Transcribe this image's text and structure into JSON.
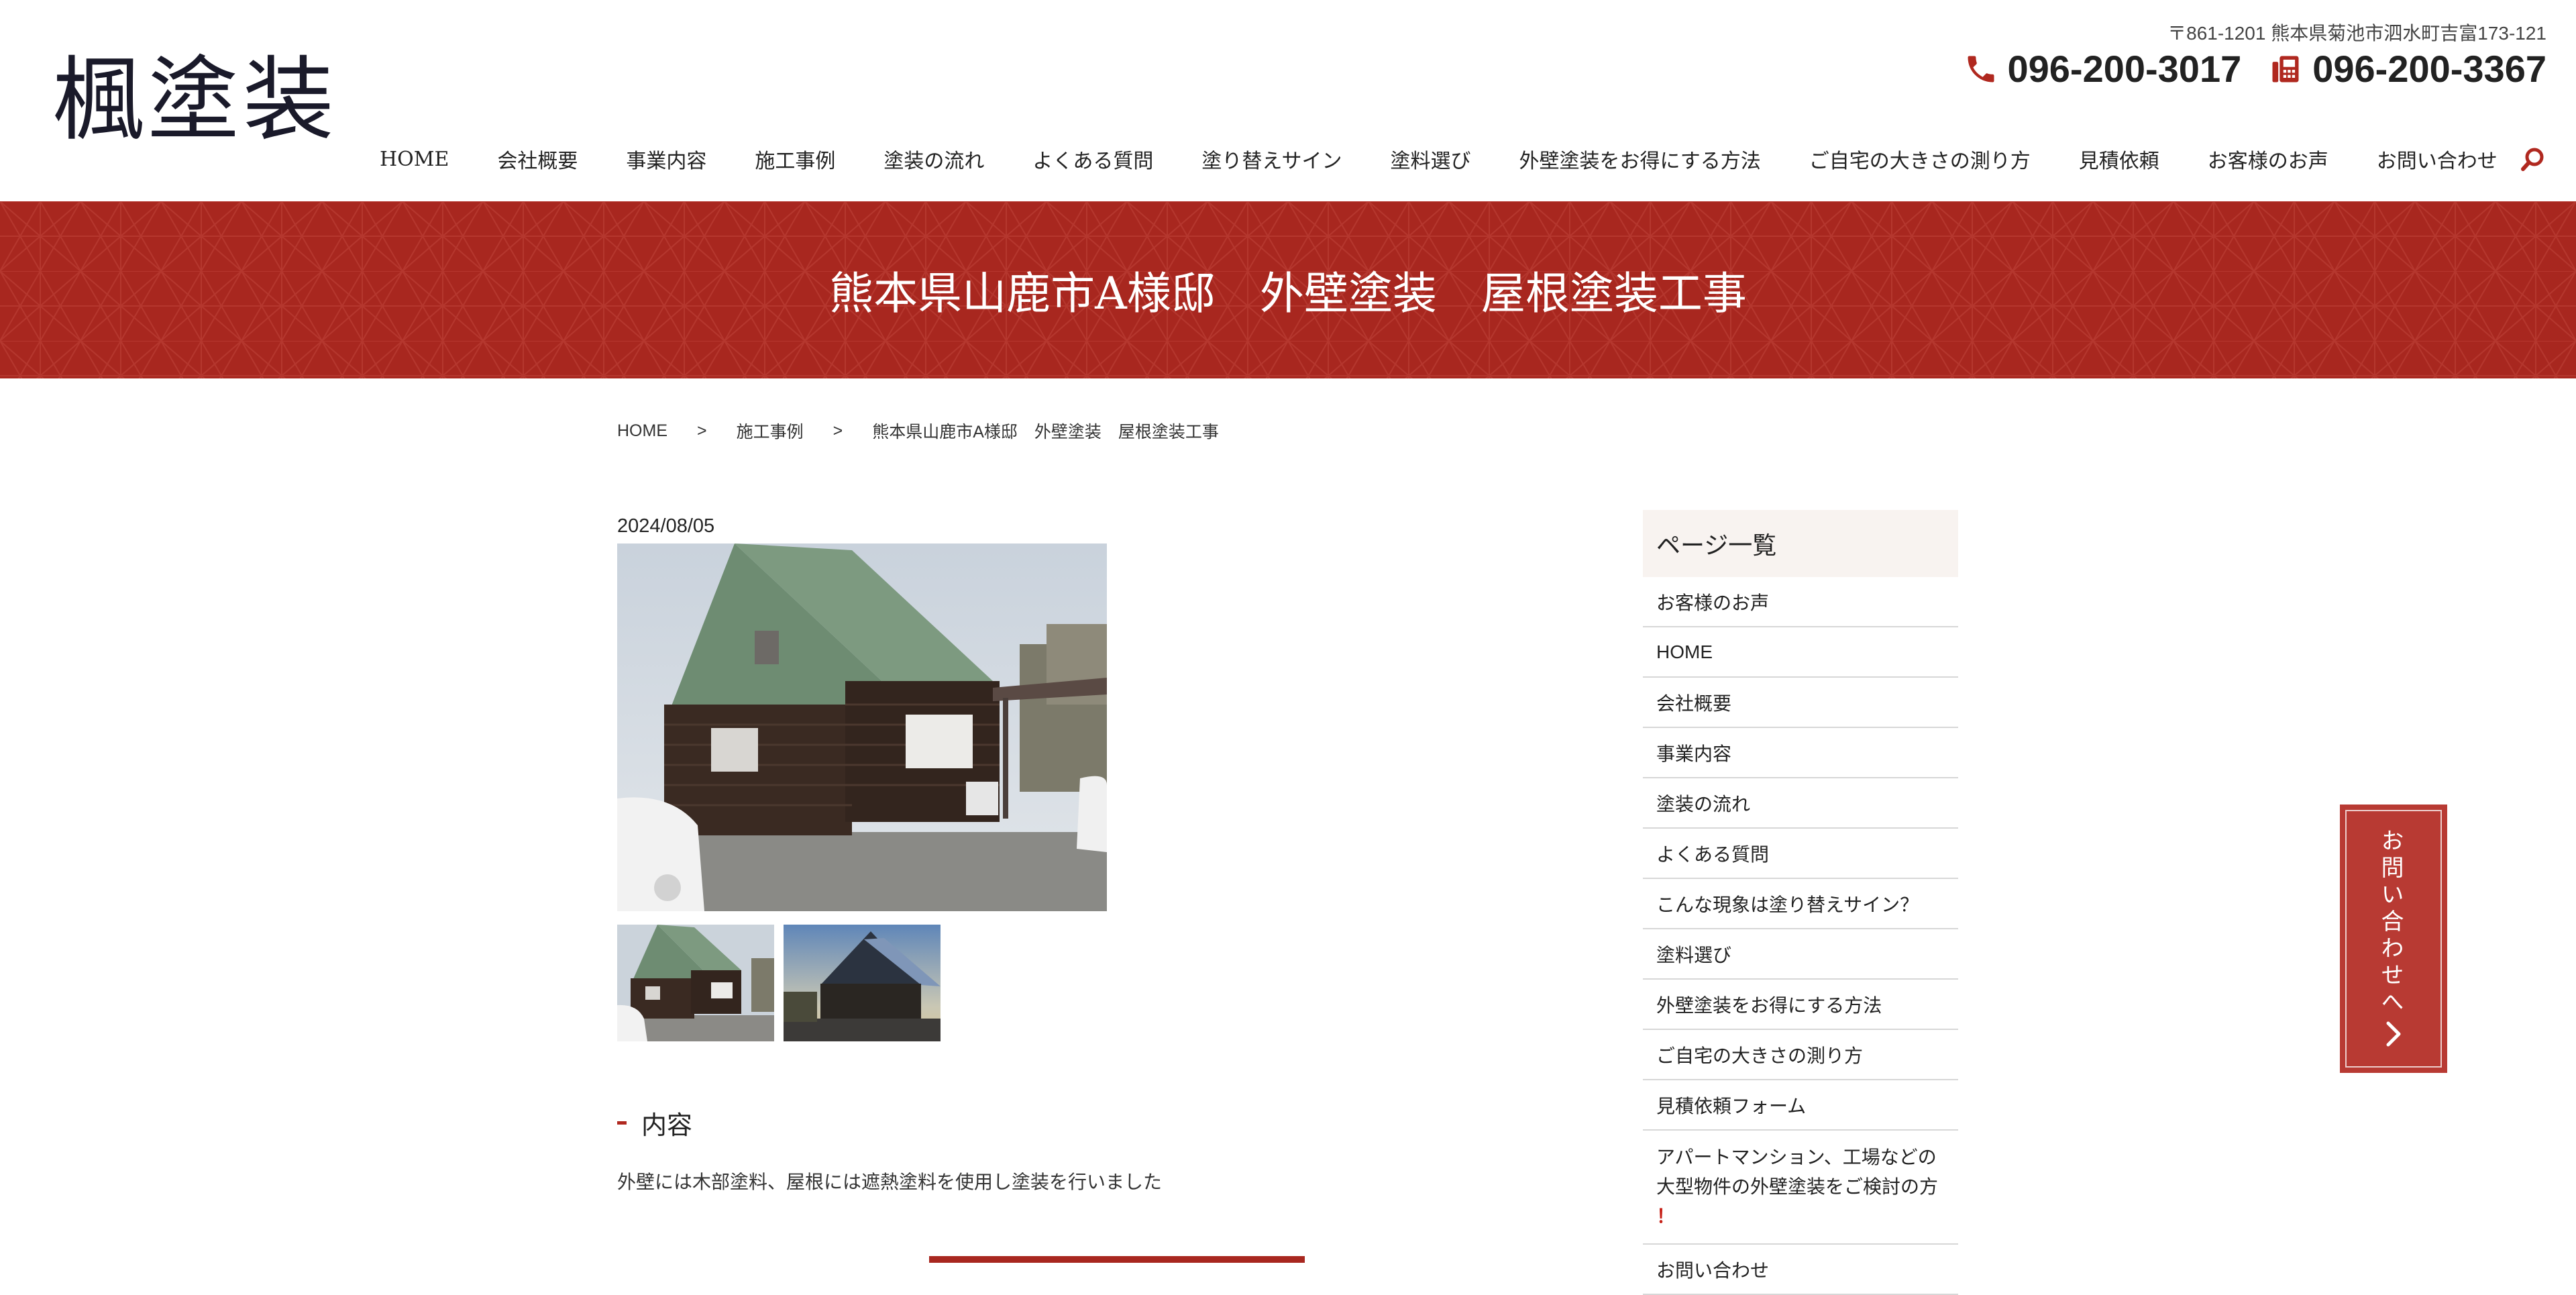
{
  "header": {
    "logo": "楓塗装",
    "address": "〒861-1201 熊本県菊池市泗水町吉富173-121",
    "phone_tel": "096-200-3017",
    "phone_fax": "096-200-3367",
    "nav": [
      "HOME",
      "会社概要",
      "事業内容",
      "施工事例",
      "塗装の流れ",
      "よくある質問",
      "塗り替えサイン",
      "塗料選び",
      "外壁塗装をお得にする方法",
      "ご自宅の大きさの測り方",
      "見積依頼",
      "お客様のお声",
      "お問い合わせ"
    ],
    "search_icon": "search-icon",
    "phone_icon": "phone-icon",
    "fax_icon": "fax-icon"
  },
  "hero": {
    "title": "熊本県山鹿市A様邸　外壁塗装　屋根塗装工事",
    "color": "#a8271f"
  },
  "breadcrumb": {
    "items": [
      "HOME",
      "施工事例",
      "熊本県山鹿市A様邸　外壁塗装　屋根塗装工事"
    ],
    "separator": ">"
  },
  "post": {
    "date": "2024/08/05",
    "section_heading": "内容",
    "section_text": "外壁には木部塗料、屋根には遮熱塗料を使用し塗装を行いました"
  },
  "sidebar": {
    "title": "ページ一覧",
    "items": [
      "お客様のお声",
      "HOME",
      "会社概要",
      "事業内容",
      "塗装の流れ",
      "よくある質問",
      "こんな現象は塗り替えサイン？",
      "塗料選び",
      "外壁塗装をお得にする方法",
      "ご自宅の大きさの測り方",
      "見積依頼フォーム"
    ],
    "long_item_line1": "アパートマンション、工場などの",
    "long_item_line2": "大型物件の外壁塗装をご検討の方",
    "long_item_mark": "！",
    "partial_item": "お問い合わせ"
  },
  "float_contact": {
    "label": "お問い合わせへ",
    "arrow_icon": "chevron-right-icon"
  },
  "colors": {
    "accent": "#a8271f",
    "sidebar_title_bg": "#f8f3f0",
    "float_bg": "#b83a33"
  }
}
